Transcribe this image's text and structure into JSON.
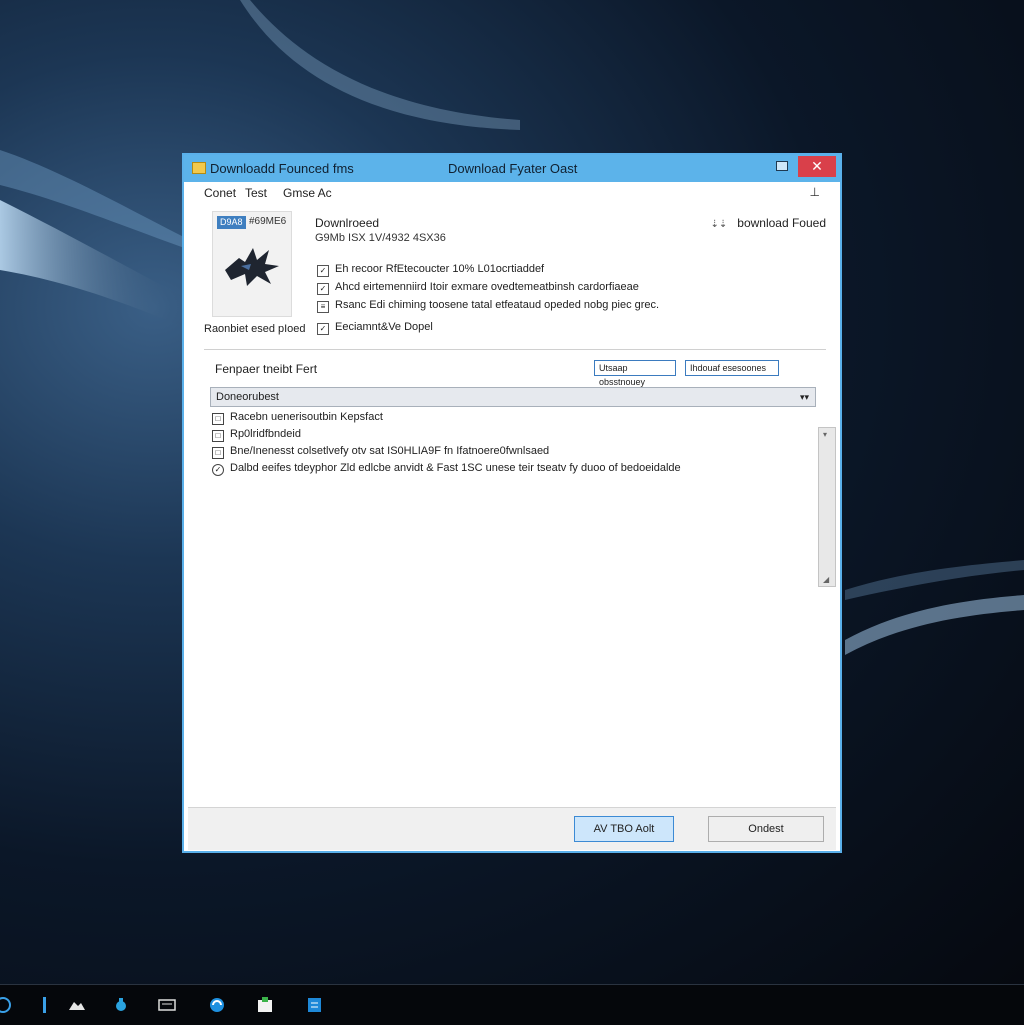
{
  "window": {
    "title_left": "Downloadd Founced fms",
    "title_center": "Download Fyater Oast",
    "close_glyph": "✕"
  },
  "menubar": {
    "items": [
      "Conet",
      "Test",
      "Gmse Ac"
    ],
    "pin_icon": "pin-icon"
  },
  "file": {
    "badge": "D9A8",
    "preview_size": "#69ME6",
    "preview_caption": "Raonbiet esed pIoed",
    "name": "Downlroeed",
    "size": "G9Mb ISX 1V/4932 4SX36",
    "status": "bownload Foued"
  },
  "checks": [
    "Eh recoor RfEtecoucter 10% L01ocrtiaddef",
    "Ahcd eirtemenniird Itoir exmare ovedtemeatbinsh cardorfiaeae",
    "Rsanc Edi chiming toosene tatal etfeataud opeded nobg piec grec.",
    "Eeciamnt&Ve Dopel"
  ],
  "section": {
    "label": "Fenpaer tneibt Fert",
    "btn_1": "Utsaap obsstnouey",
    "btn_2": "Ihdouaf esesoones"
  },
  "list": {
    "header": "Doneorubest",
    "rows": [
      "Racebn uenerisoutbin Kepsfact",
      "Rp0lridfbndeid",
      "Bne/Inenesst colsetlvefy otv sat IS0HLIA9F fn Ifatnoere0fwnlsaed",
      "Dalbd eeifes tdeyphor Zld edlcbe anvidt & Fast 1SC unese teir tseatv fy duoo of bedoeidalde"
    ]
  },
  "footer": {
    "primary": "AV TBO Aolt",
    "secondary": "Ondest"
  },
  "colors": {
    "titlebar": "#5cb3ea",
    "close": "#d9404a",
    "primary_btn": "#cde6fb",
    "accent_border": "#3c8ad4"
  },
  "taskbar": {
    "icons": [
      "browser-icon",
      "mail-icon",
      "folder-icon",
      "clock-icon",
      "store-icon",
      "document-icon"
    ]
  }
}
